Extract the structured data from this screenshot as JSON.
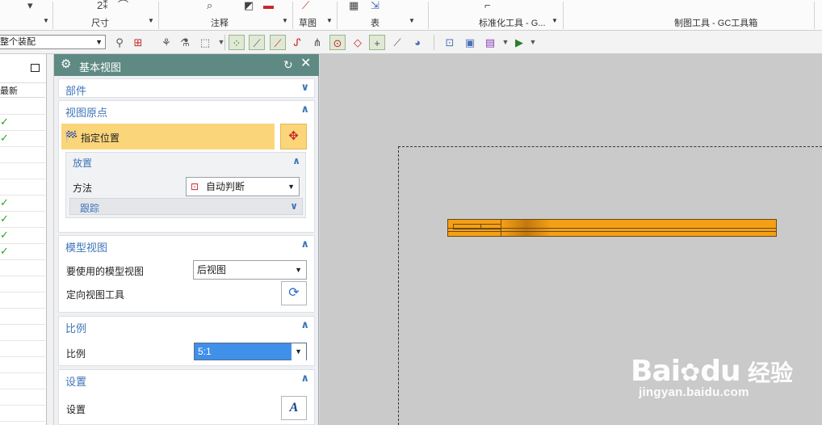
{
  "ribbon": {
    "groups": [
      {
        "label": "尺寸"
      },
      {
        "label": "注释"
      },
      {
        "label": "草图"
      },
      {
        "label": "表"
      },
      {
        "label": "标准化工具 - G..."
      },
      {
        "label": "制图工具 - GC工具箱"
      }
    ]
  },
  "toolbar": {
    "assembly_filter": "整个装配"
  },
  "navigator": {
    "column_header": "最新"
  },
  "dialog": {
    "title": "基本视图",
    "sections": {
      "part": {
        "title": "部件"
      },
      "view_origin": {
        "title": "视图原点",
        "specify_location": "指定位置",
        "placement": {
          "title": "放置",
          "method_label": "方法",
          "method_value": "自动判断",
          "track_label": "跟踪"
        }
      },
      "model_view": {
        "title": "模型视图",
        "model_view_label": "要使用的模型视图",
        "model_view_value": "后视图",
        "orient_tool_label": "定向视图工具"
      },
      "scale": {
        "title": "比例",
        "scale_label": "比例",
        "scale_value": "5:1"
      },
      "settings": {
        "title": "设置",
        "settings_label": "设置"
      }
    }
  },
  "watermark": {
    "brand": "Bai",
    "brand2": "du",
    "cn": "经验",
    "url": "jingyan.baidu.com"
  },
  "colors": {
    "dialog_title_bg": "#5e8a83",
    "section_title": "#3f75b9",
    "highlight": "#fbd57a",
    "part_fill": "#f4a017",
    "canvas_bg": "#cacaca"
  }
}
